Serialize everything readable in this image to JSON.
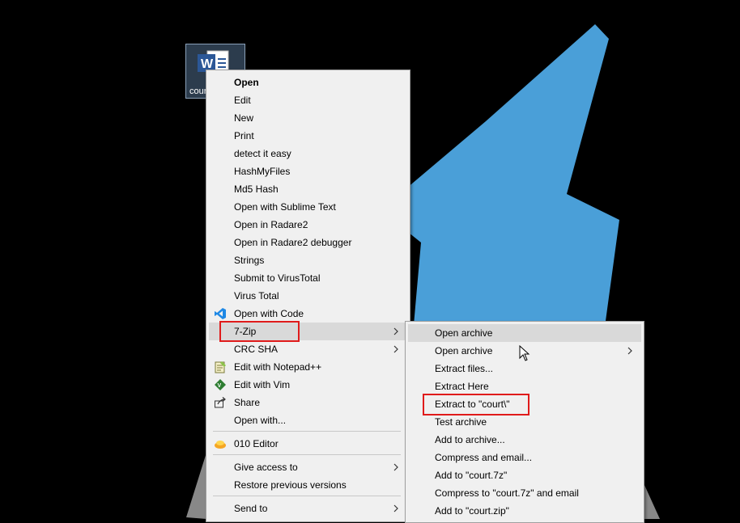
{
  "desktop": {
    "file_icon_label": "court",
    "accent_color": "#4a9fd8"
  },
  "context_menu": {
    "items": [
      {
        "label": "Open",
        "bold": true
      },
      {
        "label": "Edit"
      },
      {
        "label": "New"
      },
      {
        "label": "Print"
      },
      {
        "label": "detect it easy"
      },
      {
        "label": "HashMyFiles"
      },
      {
        "label": "Md5 Hash"
      },
      {
        "label": "Open with Sublime Text"
      },
      {
        "label": "Open in Radare2"
      },
      {
        "label": "Open in Radare2 debugger"
      },
      {
        "label": "Strings"
      },
      {
        "label": "Submit to VirusTotal"
      },
      {
        "label": "Virus Total"
      },
      {
        "label": "Open with Code",
        "icon": "vscode-icon"
      },
      {
        "label": "7-Zip",
        "submenu": true,
        "highlighted": true
      },
      {
        "label": "CRC SHA",
        "submenu": true
      },
      {
        "label": "Edit with Notepad++",
        "icon": "notepadpp-icon"
      },
      {
        "label": "Edit with Vim",
        "icon": "vim-icon"
      },
      {
        "label": "Share",
        "icon": "share-icon"
      },
      {
        "label": "Open with..."
      },
      {
        "label": "010 Editor",
        "icon": "010-editor-icon"
      },
      {
        "label": "Give access to",
        "submenu": true
      },
      {
        "label": "Restore previous versions"
      },
      {
        "label": "Send to",
        "submenu": true
      }
    ]
  },
  "zip_submenu": {
    "items": [
      {
        "label": "Open archive",
        "highlighted": true
      },
      {
        "label": "Open archive",
        "submenu": true
      },
      {
        "label": "Extract files..."
      },
      {
        "label": "Extract Here"
      },
      {
        "label": "Extract to \"court\\\"",
        "boxed": true
      },
      {
        "label": "Test archive"
      },
      {
        "label": "Add to archive..."
      },
      {
        "label": "Compress and email..."
      },
      {
        "label": "Add to \"court.7z\""
      },
      {
        "label": "Compress to \"court.7z\" and email"
      },
      {
        "label": "Add to \"court.zip\""
      }
    ]
  },
  "annotation_color": "#e01b1b"
}
